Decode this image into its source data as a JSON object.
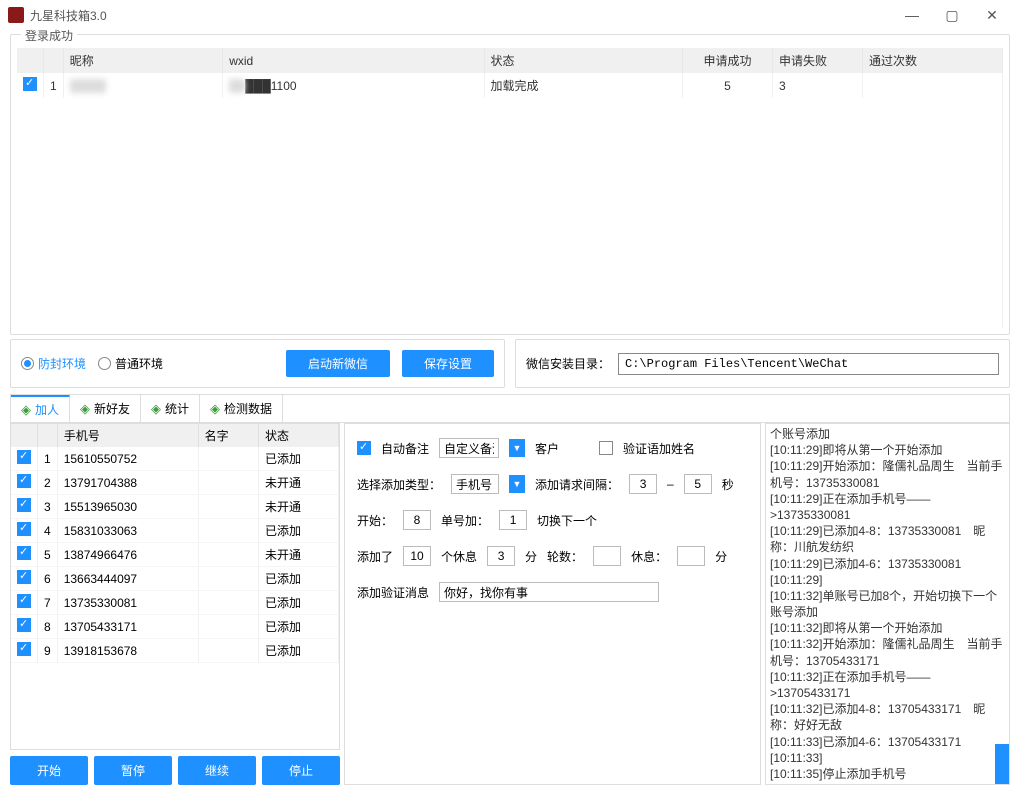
{
  "window": {
    "title": "九星科技箱3.0"
  },
  "login_panel": {
    "title": "登录成功",
    "headers": [
      "昵称",
      "wxid",
      "状态",
      "申请成功",
      "申请失败",
      "通过次数"
    ],
    "row": {
      "idx": "1",
      "nick": "███",
      "wxid": "███1100",
      "status": "加载完成",
      "succ": "5",
      "fail": "3",
      "pass": ""
    }
  },
  "env": {
    "opt1": "防封环境",
    "opt2": "普通环境",
    "btn_start": "启动新微信",
    "btn_save": "保存设置"
  },
  "path": {
    "label": "微信安装目录：",
    "value": "C:\\Program Files\\Tencent\\WeChat"
  },
  "tabs": [
    "加人",
    "新好友",
    "统计",
    "检测数据"
  ],
  "phone_grid": {
    "headers": [
      "手机号",
      "名字",
      "状态"
    ],
    "rows": [
      {
        "i": "1",
        "phone": "15610550752",
        "name": "",
        "status": "已添加"
      },
      {
        "i": "2",
        "phone": "13791704388",
        "name": "",
        "status": "未开通"
      },
      {
        "i": "3",
        "phone": "15513965030",
        "name": "",
        "status": "未开通"
      },
      {
        "i": "4",
        "phone": "15831033063",
        "name": "",
        "status": "已添加"
      },
      {
        "i": "5",
        "phone": "13874966476",
        "name": "",
        "status": "未开通"
      },
      {
        "i": "6",
        "phone": "13663444097",
        "name": "",
        "status": "已添加"
      },
      {
        "i": "7",
        "phone": "13735330081",
        "name": "",
        "status": "已添加"
      },
      {
        "i": "8",
        "phone": "13705433171",
        "name": "",
        "status": "已添加"
      },
      {
        "i": "9",
        "phone": "13918153678",
        "name": "",
        "status": "已添加"
      }
    ]
  },
  "action_btns": {
    "start": "开始",
    "pause": "暂停",
    "resume": "继续",
    "stop": "停止"
  },
  "mid": {
    "auto_remark": "自动备注",
    "custom_remark": "自定义备注",
    "customer": "客户",
    "verify_name": "验证语加姓名",
    "sel_type": "选择添加类型：",
    "phone": "手机号",
    "interval": "添加请求间隔：",
    "int_a": "3",
    "int_b": "5",
    "sec": "秒",
    "start_lbl": "开始：",
    "start_v": "8",
    "single": "单号加：",
    "single_v": "1",
    "switch": "切换下一个",
    "added": "添加了",
    "added_v": "10",
    "rest": "个休息",
    "rest_v": "3",
    "min": "分",
    "rounds": "轮数：",
    "rest2": "休息：",
    "min2": "分",
    "verify_msg": "添加验证消息",
    "verify_txt": "你好，找你有事"
  },
  "log": [
    "个账号添加",
    "[10:11:29]即将从第一个开始添加",
    "[10:11:29]开始添加：隆儒礼品周生　当前手机号：13735330081",
    "[10:11:29]正在添加手机号——>13735330081",
    "[10:11:29]已添加4-8：13735330081　昵称：川航发纺织",
    "[10:11:29]已添加4-6：13735330081",
    "[10:11:29]",
    "[10:11:32]单账号已加8个，开始切换下一个账号添加",
    "[10:11:32]即将从第一个开始添加",
    "[10:11:32]开始添加：隆儒礼品周生　当前手机号：13705433171",
    "[10:11:32]正在添加手机号——>13705433171",
    "[10:11:32]已添加4-8：13705433171　昵称：好好无敌",
    "[10:11:33]已添加4-6：13705433171",
    "[10:11:33]",
    "[10:11:35]停止添加手机号"
  ]
}
